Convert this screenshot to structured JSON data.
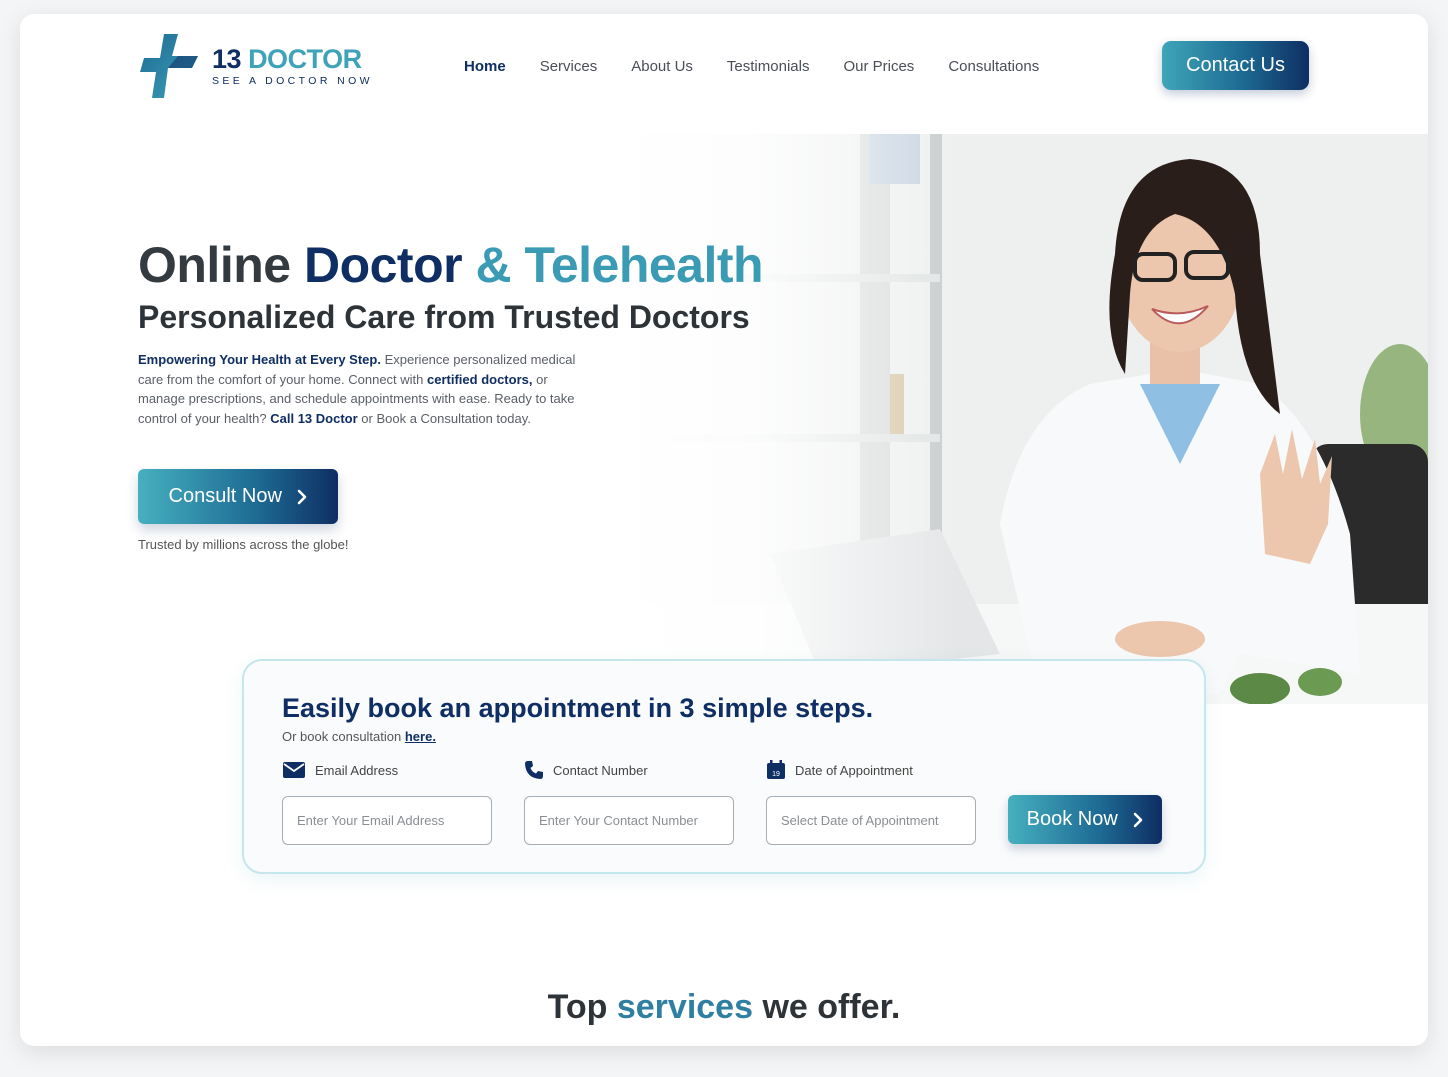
{
  "brand": {
    "name_number": "13",
    "name_word": "DOCTOR",
    "tagline": "SEE A DOCTOR NOW",
    "colors": {
      "navy": "#0f2e63",
      "teal": "#3ea2b9"
    }
  },
  "nav": {
    "items": [
      {
        "label": "Home",
        "active": true
      },
      {
        "label": "Services",
        "active": false
      },
      {
        "label": "About Us",
        "active": false
      },
      {
        "label": "Testimonials",
        "active": false
      },
      {
        "label": "Our Prices",
        "active": false
      },
      {
        "label": "Consultations",
        "active": false
      }
    ],
    "contact_label": "Contact Us"
  },
  "hero": {
    "title_part1": "Online ",
    "title_part2": "Doctor",
    "title_part3": " & ",
    "title_part4": "Telehealth",
    "subtitle": "Personalized Care from Trusted Doctors",
    "para_strong1": "Empowering Your Health at Every Step.",
    "para_text1": " Experience personalized medical care from the comfort of your home. Connect with ",
    "para_strong2": "certified doctors,",
    "para_text2": " or manage prescriptions, and schedule appointments with ease. Ready to take control of your health? ",
    "para_strong3": "Call 13 Doctor",
    "para_text3": " or Book a Consultation today.",
    "cta_label": "Consult Now",
    "trusted": "Trusted by millions across the globe!",
    "image_description_icon": "doctor-photo"
  },
  "booking": {
    "title": "Easily book an appointment in 3 simple steps.",
    "sub_text": "Or book consultation ",
    "sub_link": "here.",
    "fields": [
      {
        "label": "Email Address",
        "placeholder": "Enter Your Email Address",
        "icon": "mail-icon"
      },
      {
        "label": "Contact Number",
        "placeholder": "Enter Your Contact Number",
        "icon": "phone-icon"
      },
      {
        "label": "Date of Appointment",
        "placeholder": "Select Date of Appointment",
        "icon": "calendar-icon"
      }
    ],
    "calendar_day": "19",
    "book_label": "Book Now"
  },
  "services": {
    "heading_part1": "Top ",
    "heading_part2": "services",
    "heading_part3": " we offer."
  }
}
